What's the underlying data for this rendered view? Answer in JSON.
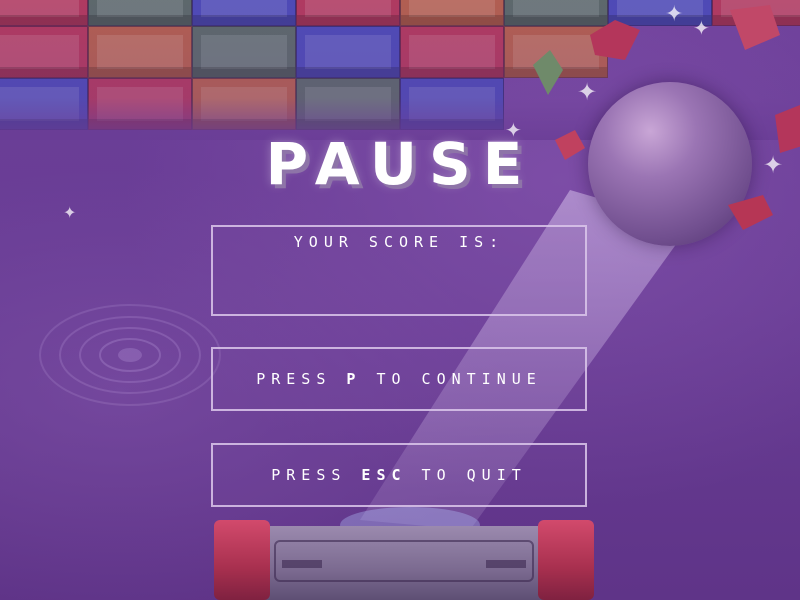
{
  "pause_screen": {
    "title": "PAUSE",
    "score_label": "YOUR SCORE IS:",
    "score_value": "",
    "continue_prefix": "PRESS",
    "continue_key": "P",
    "continue_suffix": "TO CONTINUE",
    "quit_prefix": "PRESS",
    "quit_key": "ESC",
    "quit_suffix": "TO QUIT"
  },
  "colors": {
    "background": "#6a3d96",
    "panel_border": "#dcc8eb",
    "brick_red": "#b33a5e",
    "brick_blue": "#4d4bb8",
    "brick_gray": "#5c6a6a",
    "brick_orange": "#b5604e",
    "paddle_cap": "#d24a6c"
  },
  "icons": {
    "ball": "sphere-ball",
    "paddle": "paddle",
    "stars": "sparkle-star"
  }
}
